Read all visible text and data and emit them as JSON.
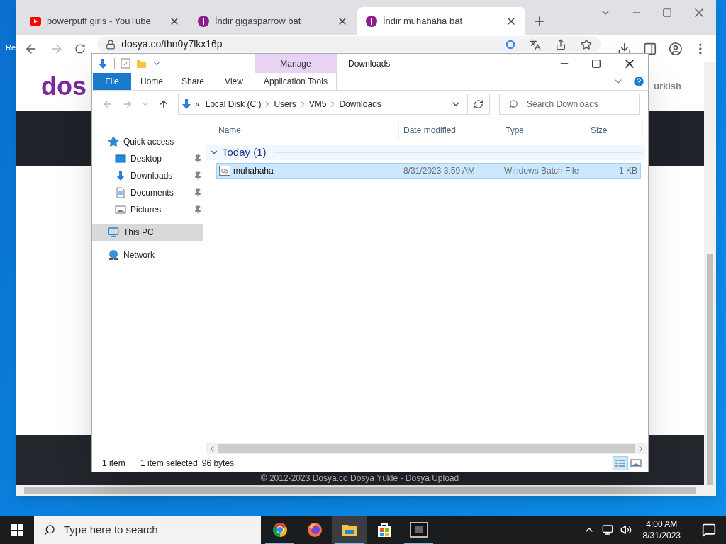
{
  "desktop": {
    "icon_label": "Re"
  },
  "browser": {
    "tabs": [
      {
        "kind": "youtube",
        "title": "powerpuff girls - YouTube",
        "selected": false
      },
      {
        "kind": "dosya",
        "title": "İndir gigasparrow bat",
        "selected": false
      },
      {
        "kind": "dosya",
        "title": "İndir muhahaha bat",
        "selected": true
      }
    ],
    "address": "dosya.co/thn0y7lkx16p",
    "page": {
      "logo": "dos",
      "language": "urkish",
      "footer": "© 2012-2023 Dosya.co Dosya Yükle - Dosya Upload"
    }
  },
  "explorer": {
    "title": "Downloads",
    "context_tab": "Manage",
    "ribbon_tabs": [
      {
        "kind": "file",
        "label": "File"
      },
      {
        "kind": "tab",
        "label": "Home"
      },
      {
        "kind": "tab",
        "label": "Share"
      },
      {
        "kind": "tab",
        "label": "View"
      },
      {
        "kind": "context",
        "label": "Application Tools"
      }
    ],
    "breadcrumb_prefix": "«",
    "breadcrumb": [
      "Local Disk (C:)",
      "Users",
      "VM5",
      "Downloads"
    ],
    "search_placeholder": "Search Downloads",
    "nav": [
      {
        "kind": "quick",
        "label": "Quick access",
        "selected": false,
        "children": [
          {
            "kind": "desktop",
            "label": "Desktop",
            "pinned": true,
            "selected": false
          },
          {
            "kind": "downloads",
            "label": "Downloads",
            "pinned": true,
            "selected": false
          },
          {
            "kind": "documents",
            "label": "Documents",
            "pinned": true,
            "selected": false
          },
          {
            "kind": "pictures",
            "label": "Pictures",
            "pinned": true,
            "selected": false
          }
        ]
      },
      {
        "kind": "pc",
        "label": "This PC",
        "selected": true
      },
      {
        "kind": "network",
        "label": "Network",
        "selected": false
      }
    ],
    "columns": [
      "Name",
      "Date modified",
      "Type",
      "Size"
    ],
    "groups": [
      {
        "label": "Today (1)",
        "expanded": true,
        "files": [
          {
            "name": "muhahaha",
            "date": "8/31/2023 3:59 AM",
            "type": "Windows Batch File",
            "size": "1 KB",
            "selected": true
          }
        ]
      }
    ],
    "status": {
      "count": "1 item",
      "selection": "1 item selected",
      "size": "96 bytes"
    },
    "view_buttons": [
      {
        "kind": "details",
        "selected": true
      },
      {
        "kind": "large",
        "selected": false
      }
    ]
  },
  "taskbar": {
    "search_placeholder": "Type here to search",
    "apps": [
      {
        "kind": "chrome",
        "running": true,
        "selected": false
      },
      {
        "kind": "firefox",
        "running": false,
        "selected": false
      },
      {
        "kind": "explorer",
        "running": true,
        "selected": true
      },
      {
        "kind": "store",
        "running": false,
        "selected": false
      },
      {
        "kind": "console",
        "running": true,
        "selected": false
      }
    ],
    "time": "4:00 AM",
    "date": "8/31/2023"
  }
}
